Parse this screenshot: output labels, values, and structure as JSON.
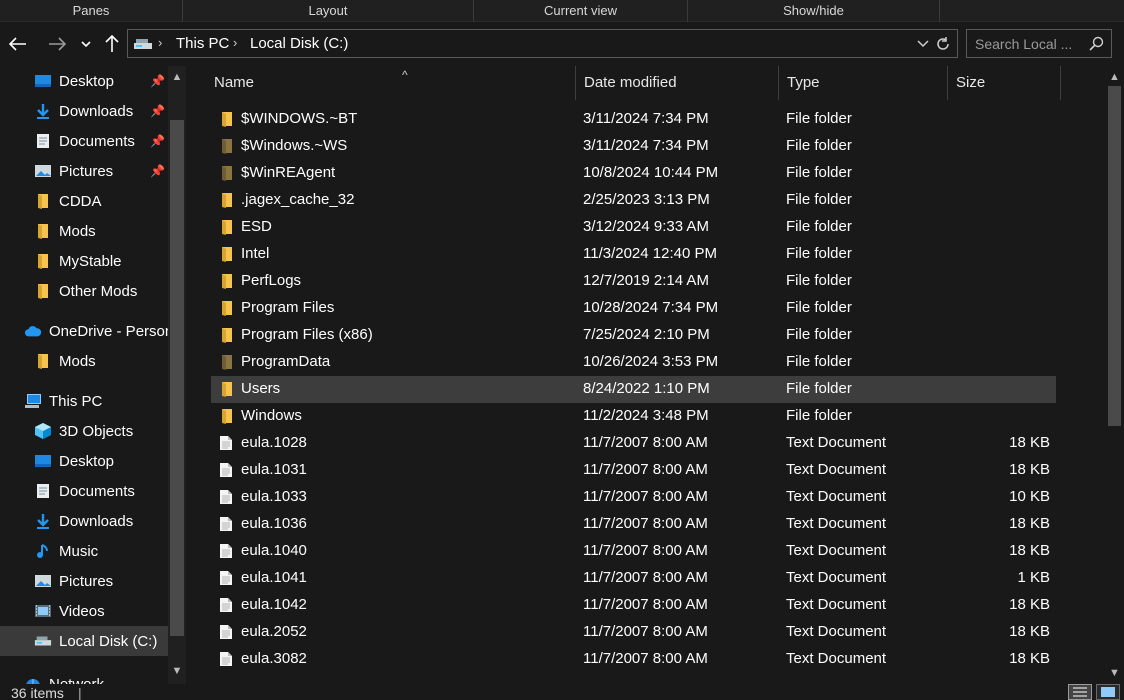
{
  "ribbon": {
    "groups": [
      "Panes",
      "Layout",
      "Current view",
      "Show/hide"
    ]
  },
  "nav": {
    "breadcrumb": [
      "This PC",
      "Local Disk (C:)"
    ],
    "search_placeholder": "Search Local ..."
  },
  "sidebar": {
    "quick_access": [
      {
        "label": "Desktop",
        "icon": "desktop-icon",
        "pinned": true
      },
      {
        "label": "Downloads",
        "icon": "download-icon",
        "pinned": true
      },
      {
        "label": "Documents",
        "icon": "documents-icon",
        "pinned": true
      },
      {
        "label": "Pictures",
        "icon": "pictures-icon",
        "pinned": true
      },
      {
        "label": "CDDA",
        "icon": "folder-icon",
        "pinned": false
      },
      {
        "label": "Mods",
        "icon": "folder-icon",
        "pinned": false
      },
      {
        "label": "MyStable",
        "icon": "folder-icon",
        "pinned": false
      },
      {
        "label": "Other Mods",
        "icon": "folder-icon",
        "pinned": false
      }
    ],
    "onedrive": {
      "label": "OneDrive - Person",
      "child": "Mods"
    },
    "this_pc": {
      "label": "This PC",
      "items": [
        {
          "label": "3D Objects",
          "icon": "3d-objects-icon"
        },
        {
          "label": "Desktop",
          "icon": "desktop-icon"
        },
        {
          "label": "Documents",
          "icon": "documents-icon"
        },
        {
          "label": "Downloads",
          "icon": "download-icon"
        },
        {
          "label": "Music",
          "icon": "music-icon"
        },
        {
          "label": "Pictures",
          "icon": "pictures-icon"
        },
        {
          "label": "Videos",
          "icon": "videos-icon"
        },
        {
          "label": "Local Disk (C:)",
          "icon": "drive-icon",
          "selected": true
        }
      ]
    },
    "network": "Network"
  },
  "columns": [
    "Name",
    "Date modified",
    "Type",
    "Size"
  ],
  "files": [
    {
      "name": "$WINDOWS.~BT",
      "date": "3/11/2024 7:34 PM",
      "type": "File folder",
      "size": "",
      "icon": "folder-icon",
      "hidden": false
    },
    {
      "name": "$Windows.~WS",
      "date": "3/11/2024 7:34 PM",
      "type": "File folder",
      "size": "",
      "icon": "folder-icon",
      "hidden": true
    },
    {
      "name": "$WinREAgent",
      "date": "10/8/2024 10:44 PM",
      "type": "File folder",
      "size": "",
      "icon": "folder-icon",
      "hidden": true
    },
    {
      "name": ".jagex_cache_32",
      "date": "2/25/2023 3:13 PM",
      "type": "File folder",
      "size": "",
      "icon": "folder-icon",
      "hidden": false
    },
    {
      "name": "ESD",
      "date": "3/12/2024 9:33 AM",
      "type": "File folder",
      "size": "",
      "icon": "folder-icon",
      "hidden": false
    },
    {
      "name": "Intel",
      "date": "11/3/2024 12:40 PM",
      "type": "File folder",
      "size": "",
      "icon": "folder-icon",
      "hidden": false
    },
    {
      "name": "PerfLogs",
      "date": "12/7/2019 2:14 AM",
      "type": "File folder",
      "size": "",
      "icon": "folder-icon",
      "hidden": false
    },
    {
      "name": "Program Files",
      "date": "10/28/2024 7:34 PM",
      "type": "File folder",
      "size": "",
      "icon": "folder-icon",
      "hidden": false
    },
    {
      "name": "Program Files (x86)",
      "date": "7/25/2024 2:10 PM",
      "type": "File folder",
      "size": "",
      "icon": "folder-icon",
      "hidden": false
    },
    {
      "name": "ProgramData",
      "date": "10/26/2024 3:53 PM",
      "type": "File folder",
      "size": "",
      "icon": "folder-icon",
      "hidden": true
    },
    {
      "name": "Users",
      "date": "8/24/2022 1:10 PM",
      "type": "File folder",
      "size": "",
      "icon": "folder-icon",
      "hidden": false,
      "selected": true
    },
    {
      "name": "Windows",
      "date": "11/2/2024 3:48 PM",
      "type": "File folder",
      "size": "",
      "icon": "folder-icon",
      "hidden": false
    },
    {
      "name": "eula.1028",
      "date": "11/7/2007 8:00 AM",
      "type": "Text Document",
      "size": "18 KB",
      "icon": "text-file-icon"
    },
    {
      "name": "eula.1031",
      "date": "11/7/2007 8:00 AM",
      "type": "Text Document",
      "size": "18 KB",
      "icon": "text-file-icon"
    },
    {
      "name": "eula.1033",
      "date": "11/7/2007 8:00 AM",
      "type": "Text Document",
      "size": "10 KB",
      "icon": "text-file-icon"
    },
    {
      "name": "eula.1036",
      "date": "11/7/2007 8:00 AM",
      "type": "Text Document",
      "size": "18 KB",
      "icon": "text-file-icon"
    },
    {
      "name": "eula.1040",
      "date": "11/7/2007 8:00 AM",
      "type": "Text Document",
      "size": "18 KB",
      "icon": "text-file-icon"
    },
    {
      "name": "eula.1041",
      "date": "11/7/2007 8:00 AM",
      "type": "Text Document",
      "size": "1 KB",
      "icon": "text-file-icon"
    },
    {
      "name": "eula.1042",
      "date": "11/7/2007 8:00 AM",
      "type": "Text Document",
      "size": "18 KB",
      "icon": "text-file-icon"
    },
    {
      "name": "eula.2052",
      "date": "11/7/2007 8:00 AM",
      "type": "Text Document",
      "size": "18 KB",
      "icon": "text-file-icon"
    },
    {
      "name": "eula.3082",
      "date": "11/7/2007 8:00 AM",
      "type": "Text Document",
      "size": "18 KB",
      "icon": "text-file-icon"
    }
  ],
  "status": {
    "item_count": "36 items"
  },
  "colors": {
    "background": "#191919",
    "selected_row": "#3d3d3d",
    "folder": "#f4c44e",
    "folder_hidden": "#8a7440",
    "accent_blue": "#1e90ff"
  }
}
